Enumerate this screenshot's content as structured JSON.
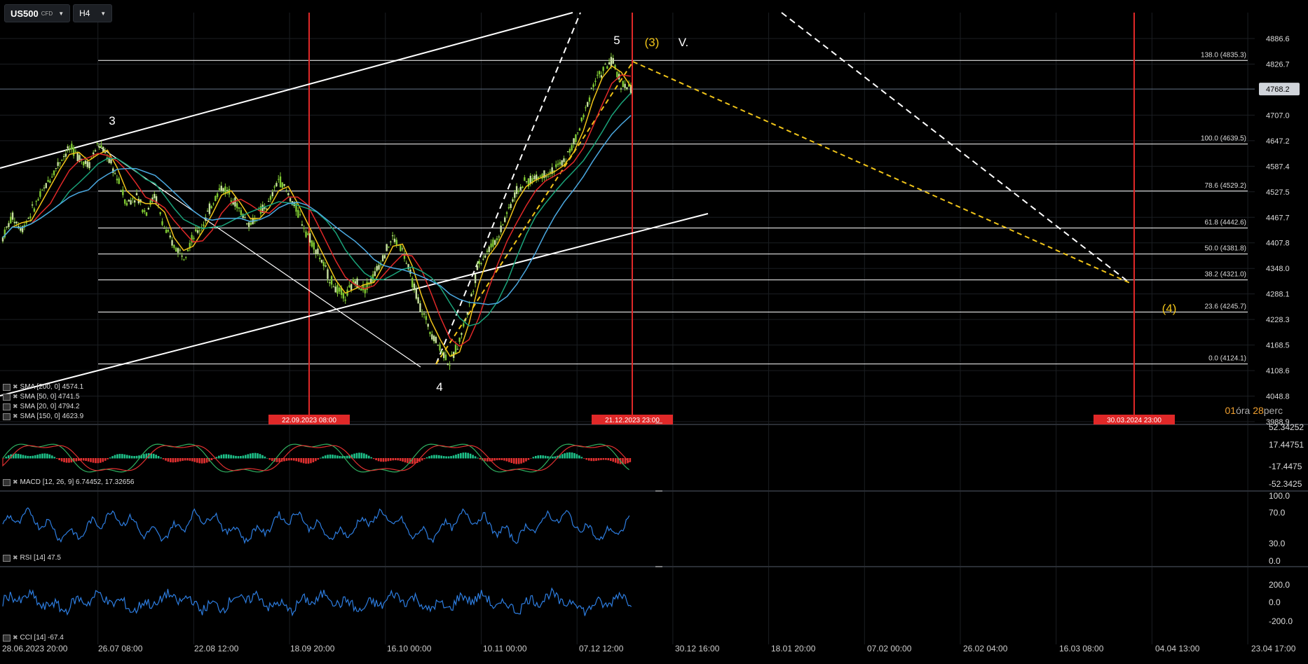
{
  "toolbar": {
    "symbol": "US500",
    "symbol_type": "CFD",
    "timeframe": "H4"
  },
  "colors": {
    "background": "#000000",
    "grid": "#1b1e22",
    "candle": "#7ec832",
    "sma20": "#f0c419",
    "sma50": "#e02828",
    "sma150": "#1aa37a",
    "sma200": "#4aa8e0",
    "fib": "#ffffff",
    "marker": "#e02828",
    "wave_yellow": "#f0c419",
    "price_line": "#607080",
    "osc": "#2d7de0",
    "macd_pos": "#1ec28a",
    "macd_neg": "#e03030"
  },
  "chart_data": {
    "type": "line",
    "title": "",
    "price_axis": {
      "ticks": [
        "4886.6",
        "4826.7",
        "4768.2",
        "4707.0",
        "4647.2",
        "4587.4",
        "4527.5",
        "4467.7",
        "4407.8",
        "4348.0",
        "4288.1",
        "4228.3",
        "4168.5",
        "4108.6",
        "4048.8",
        "3988.9"
      ],
      "current_price": "4768.2"
    },
    "x_axis_labels": [
      "28.06.2023 20:00",
      "26.07 08:00",
      "22.08 12:00",
      "18.09 20:00",
      "16.10 00:00",
      "10.11 00:00",
      "07.12 12:00",
      "30.12 16:00",
      "18.01 20:00",
      "07.02 00:00",
      "26.02 04:00",
      "16.03 08:00",
      "04.04 13:00",
      "23.04 17:00"
    ],
    "fibonacci": [
      {
        "label": "138.0 (4835.3)",
        "price": 4835.3
      },
      {
        "label": "100.0 (4639.5)",
        "price": 4639.5
      },
      {
        "label": "78.6 (4529.2)",
        "price": 4529.2
      },
      {
        "label": "61.8 (4442.6)",
        "price": 4442.6
      },
      {
        "label": "50.0 (4381.8)",
        "price": 4381.8
      },
      {
        "label": "38.2 (4321.0)",
        "price": 4321.0
      },
      {
        "label": "23.6 (4245.7)",
        "price": 4245.7
      },
      {
        "label": "0.0 (4124.1)",
        "price": 4124.1
      }
    ],
    "time_markers": [
      "22.09.2023 08:00",
      "21.12.2023 23:00",
      "30.03.2024 23:00"
    ],
    "wave_labels": [
      {
        "text": "3",
        "color": "white"
      },
      {
        "text": "4",
        "color": "white"
      },
      {
        "text": "5",
        "color": "white"
      },
      {
        "text": "(3)",
        "color": "yellow"
      },
      {
        "text": "V.",
        "color": "white"
      },
      {
        "text": "(4)",
        "color": "yellow"
      }
    ],
    "series": [
      {
        "name": "SMA [200, 0]",
        "last": 4574.1
      },
      {
        "name": "SMA [50, 0]",
        "last": 4741.5
      },
      {
        "name": "SMA [20, 0]",
        "last": 4794.2
      },
      {
        "name": "SMA [150, 0]",
        "last": 4623.9
      }
    ],
    "price_path": [
      [
        4420,
        "28.06"
      ],
      [
        4470
      ],
      [
        4440
      ],
      [
        4480
      ],
      [
        4520
      ],
      [
        4560
      ],
      [
        4600
      ],
      [
        4630
      ],
      [
        4610
      ],
      [
        4590
      ],
      [
        4640
      ],
      [
        4610
      ],
      [
        4560
      ],
      [
        4500
      ],
      [
        4520
      ],
      [
        4480
      ],
      [
        4520
      ],
      [
        4440
      ],
      [
        4400
      ],
      [
        4380
      ],
      [
        4420
      ],
      [
        4450
      ],
      [
        4500
      ],
      [
        4540
      ],
      [
        4520
      ],
      [
        4480
      ],
      [
        4450
      ],
      [
        4480
      ],
      [
        4500
      ],
      [
        4560
      ],
      [
        4520
      ],
      [
        4480
      ],
      [
        4430
      ],
      [
        4390
      ],
      [
        4340
      ],
      [
        4300
      ],
      [
        4280
      ],
      [
        4320
      ],
      [
        4300
      ],
      [
        4330
      ],
      [
        4380
      ],
      [
        4420
      ],
      [
        4390
      ],
      [
        4320
      ],
      [
        4250
      ],
      [
        4200
      ],
      [
        4160
      ],
      [
        4124
      ],
      [
        4180
      ],
      [
        4260
      ],
      [
        4360
      ],
      [
        4390
      ],
      [
        4420
      ],
      [
        4480
      ],
      [
        4530
      ],
      [
        4550
      ],
      [
        4560
      ],
      [
        4570
      ],
      [
        4580
      ],
      [
        4600
      ],
      [
        4640
      ],
      [
        4700
      ],
      [
        4780
      ],
      [
        4810
      ],
      [
        4835
      ],
      [
        4780
      ],
      [
        4768
      ]
    ],
    "indicators": [
      {
        "name": "MACD [12, 26, 9]",
        "values": "6.74452, 17.32656",
        "ticks": [
          "52.34252",
          "17.44751",
          "-17.4475",
          "-52.3425"
        ]
      },
      {
        "name": "RSI [14]",
        "values": "47.5",
        "ticks": [
          "100.0",
          "70.0",
          "30.0",
          "0.0"
        ]
      },
      {
        "name": "CCI [14]",
        "values": "-67.4",
        "ticks": [
          "200.0",
          "0.0",
          "-200.0"
        ]
      }
    ]
  },
  "legend": {
    "sma200": "SMA [200,  0]  4574.1",
    "sma50": "SMA [50,  0]  4741.5",
    "sma20": "SMA [20,  0]  4794.2",
    "sma150": "SMA [150,  0]  4623.9",
    "macd": "MACD [12,  26,  9]  6.74452,  17.32656",
    "rsi": "RSI [14]  47.5",
    "cci": "CCI [14]  -67.4"
  },
  "countdown": {
    "hours": "01",
    "hours_unit": "óra",
    "minutes": "28",
    "minutes_unit": "perc"
  }
}
